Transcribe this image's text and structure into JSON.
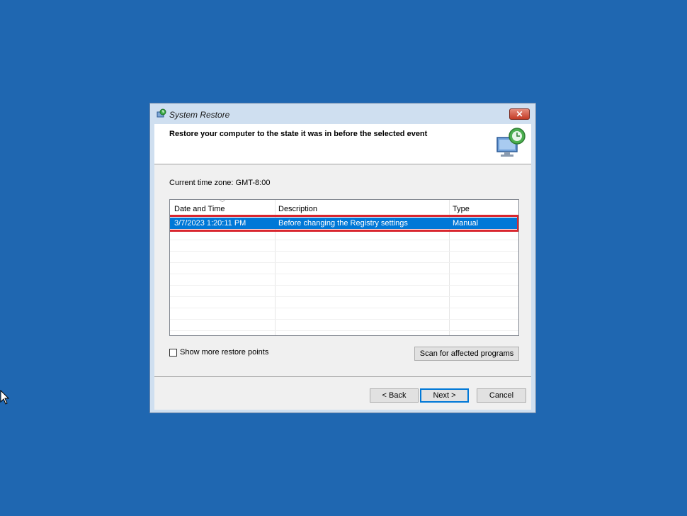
{
  "window": {
    "title": "System Restore",
    "close_label": "✕"
  },
  "header": {
    "title": "Restore your computer to the state it was in before the selected event"
  },
  "timezone_label": "Current time zone: GMT-8:00",
  "table": {
    "columns": [
      "Date and Time",
      "Description",
      "Type"
    ],
    "rows": [
      {
        "date": "3/7/2023 1:20:11 PM",
        "description": "Before changing the Registry settings",
        "type": "Manual",
        "selected": true
      }
    ]
  },
  "show_more_label": "Show more restore points",
  "scan_button_label": "Scan for affected programs",
  "back_button_label": "< Back",
  "next_button_label": "Next >",
  "cancel_button_label": "Cancel",
  "colors": {
    "desktop": "#1f67b1",
    "selection": "#0078d7",
    "highlight_box": "#d9262e"
  },
  "icons": [
    "system-restore-icon",
    "close-icon",
    "restore-monitor-icon",
    "mouse-cursor-icon"
  ]
}
